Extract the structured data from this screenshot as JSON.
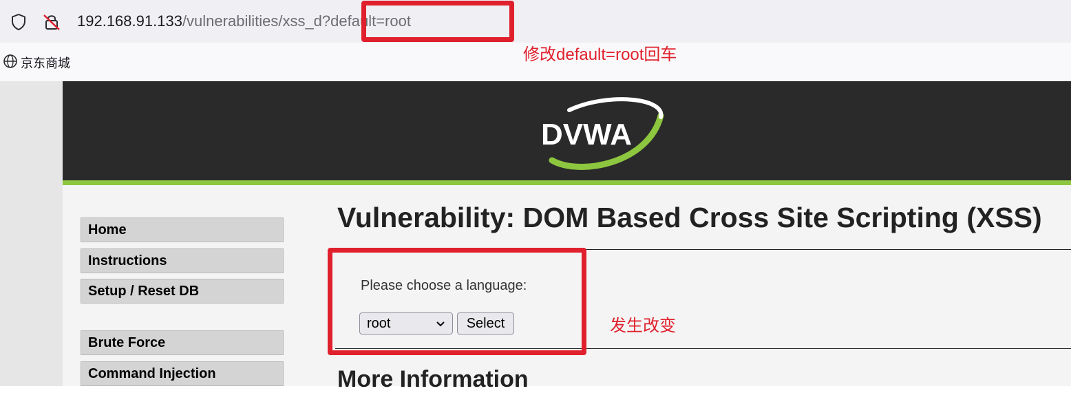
{
  "browser": {
    "url_host": "192.168.91.133",
    "url_path": "/vulnerabilities/xss_d",
    "url_query": "?default=root",
    "bookmarks": [
      {
        "label": "京东商城",
        "icon": "globe-icon"
      }
    ]
  },
  "header": {
    "logo_text": "DVWA"
  },
  "sidebar": {
    "items": [
      {
        "label": "Home"
      },
      {
        "label": "Instructions"
      },
      {
        "label": "Setup / Reset DB"
      },
      {
        "label": "Brute Force"
      },
      {
        "label": "Command Injection"
      }
    ]
  },
  "main": {
    "title": "Vulnerability: DOM Based Cross Site Scripting (XSS)",
    "choose_label": "Please choose a language:",
    "language_select": {
      "selected": "root"
    },
    "select_button": "Select",
    "more_info_heading": "More Information"
  },
  "annotations": {
    "url_note": "修改default=root回车",
    "form_note": "发生改变"
  },
  "colors": {
    "annotation_red": "#e0202c",
    "dvwa_green": "#8dc63f",
    "header_dark": "#2a2a2a"
  }
}
